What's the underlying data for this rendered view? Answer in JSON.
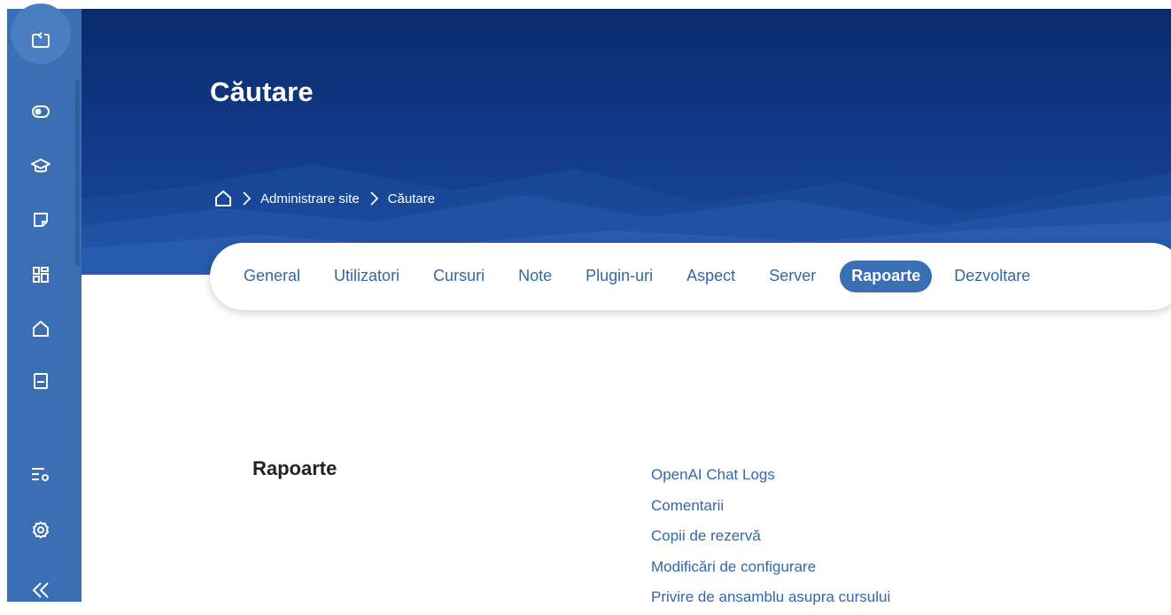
{
  "sidebar": {
    "items": [
      {
        "icon": "expand-drawer-icon"
      },
      {
        "icon": "toggle-icon"
      },
      {
        "icon": "graduation-cap-icon"
      },
      {
        "icon": "note-icon"
      },
      {
        "icon": "dashboard-grid-icon"
      },
      {
        "icon": "home-icon"
      },
      {
        "icon": "book-icon"
      },
      {
        "icon": "list-settings-icon"
      },
      {
        "icon": "gear-icon"
      },
      {
        "icon": "collapse-icon"
      }
    ]
  },
  "header": {
    "title": "Căutare",
    "breadcrumb": {
      "home_icon": "home-icon",
      "items": [
        "Administrare site",
        "Căutare"
      ]
    }
  },
  "tabs": {
    "items": [
      "General",
      "Utilizatori",
      "Cursuri",
      "Note",
      "Plugin-uri",
      "Aspect",
      "Server",
      "Rapoarte",
      "Dezvoltare"
    ],
    "active": "Rapoarte"
  },
  "content": {
    "section_title": "Rapoarte",
    "links": [
      "OpenAI Chat Logs",
      "Comentarii",
      "Copii de rezervă",
      "Modificări de configurare",
      "Privire de ansamblu asupra cursului"
    ]
  },
  "colors": {
    "sidebar": "#3a6fb4",
    "header_dark": "#0b2a6e",
    "link": "#3367a8",
    "active_tab": "#3a6fb4"
  }
}
